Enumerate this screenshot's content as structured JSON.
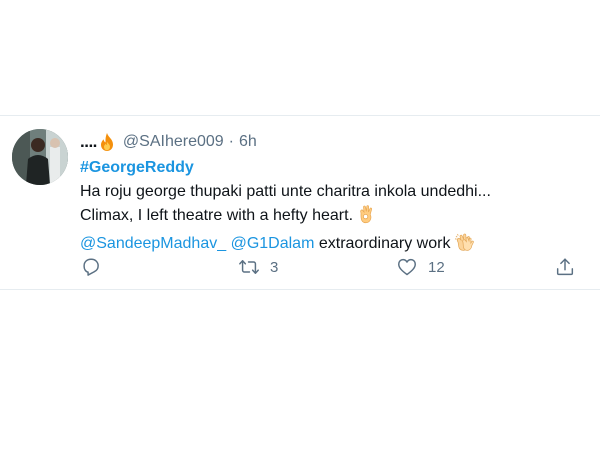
{
  "tweet": {
    "display_name": "....",
    "display_name_emoji": "fire-icon",
    "handle": "@SAIhere009",
    "separator": "·",
    "time": "6h",
    "hashtag": "#GeorgeReddy",
    "line1": "Ha roju george thupaki patti unte charitra inkola undedhi...",
    "line2": "Climax, I left theatre with a hefty heart.",
    "line2_emoji": "ok-hand-icon",
    "mention1": "@SandeepMadhav_",
    "mention2": "@G1Dalam",
    "line3_text": " extraordinary work",
    "line3_emoji": "clapping-hands-icon"
  },
  "actions": {
    "reply_icon": "reply-icon",
    "retweet_icon": "retweet-icon",
    "retweet_count": "3",
    "like_icon": "heart-icon",
    "like_count": "12",
    "share_icon": "share-icon"
  },
  "colors": {
    "link": "#1b95e0",
    "text": "#0f1419",
    "secondary": "#5b7083",
    "border": "#e6ecf0"
  }
}
